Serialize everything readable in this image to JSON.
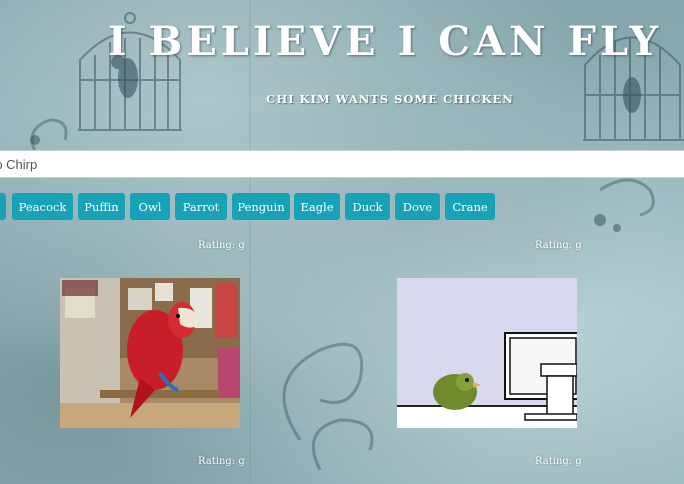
{
  "header": {
    "title": "I BELIEVE I CAN FLY",
    "subtitle": "CHI KIM WANTS SOME CHICKEN"
  },
  "search": {
    "value": "rp Chirp",
    "placeholder": ""
  },
  "buttons": [
    "",
    "Peacock",
    "Puffin",
    "Owl",
    "Parrot",
    "Penguin",
    "Eagle",
    "Duck",
    "Dove",
    "Crane"
  ],
  "results": [
    {
      "rating": "Rating: g",
      "description": "red parrot"
    },
    {
      "rating": "Rating: g",
      "description": "green bird cartoon"
    }
  ],
  "results_bottom": [
    {
      "rating": "Rating: g"
    },
    {
      "rating": "Rating: g"
    }
  ],
  "colors": {
    "button": "#17a2b8",
    "background": "#8eb0b6"
  },
  "icons": [
    "birdcage-icon",
    "birdcage-icon"
  ]
}
